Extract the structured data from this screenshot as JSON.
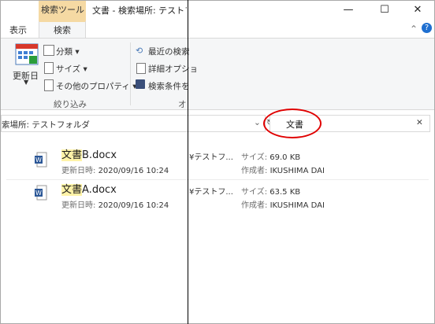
{
  "titlebar": {
    "context_tab": "検索ツール",
    "title": "文書 - 検索場所: テストフォル",
    "minimize_icon": "minimize-icon",
    "maximize_icon": "maximize-icon",
    "close_icon": "close-icon"
  },
  "tabs": [
    {
      "label": "表示"
    },
    {
      "label": "検索"
    }
  ],
  "ribbon": {
    "refresh_label": "更新日",
    "kind_label": "分類",
    "size_label": "サイズ",
    "other_props_label": "その他のプロパティ",
    "recent_label": "最近の検索",
    "advanced_label": "詳細オプショ",
    "save_label": "検索条件を",
    "group_refine": "絞り込み",
    "group_options": "オ"
  },
  "address": {
    "path": "索場所: テストフォルダ"
  },
  "search": {
    "query": "文書"
  },
  "files": [
    {
      "highlight": "文書",
      "name_rest": "B.docx",
      "modified_label": "更新日時:",
      "modified": "2020/09/16 10:24",
      "location": "¥テストフ...",
      "size_label": "サイズ:",
      "size": "69.0 KB",
      "author_label": "作成者:",
      "author": "IKUSHIMA DAI"
    },
    {
      "highlight": "文書",
      "name_rest": "A.docx",
      "modified_label": "更新日時:",
      "modified": "2020/09/16 10:24",
      "location": "¥テストフ...",
      "size_label": "サイズ:",
      "size": "63.5 KB",
      "author_label": "作成者:",
      "author": "IKUSHIMA DAI"
    }
  ],
  "colors": {
    "highlight": "#fff3a8",
    "annotation": "#e00000",
    "context_tab": "#f5d9a3"
  }
}
